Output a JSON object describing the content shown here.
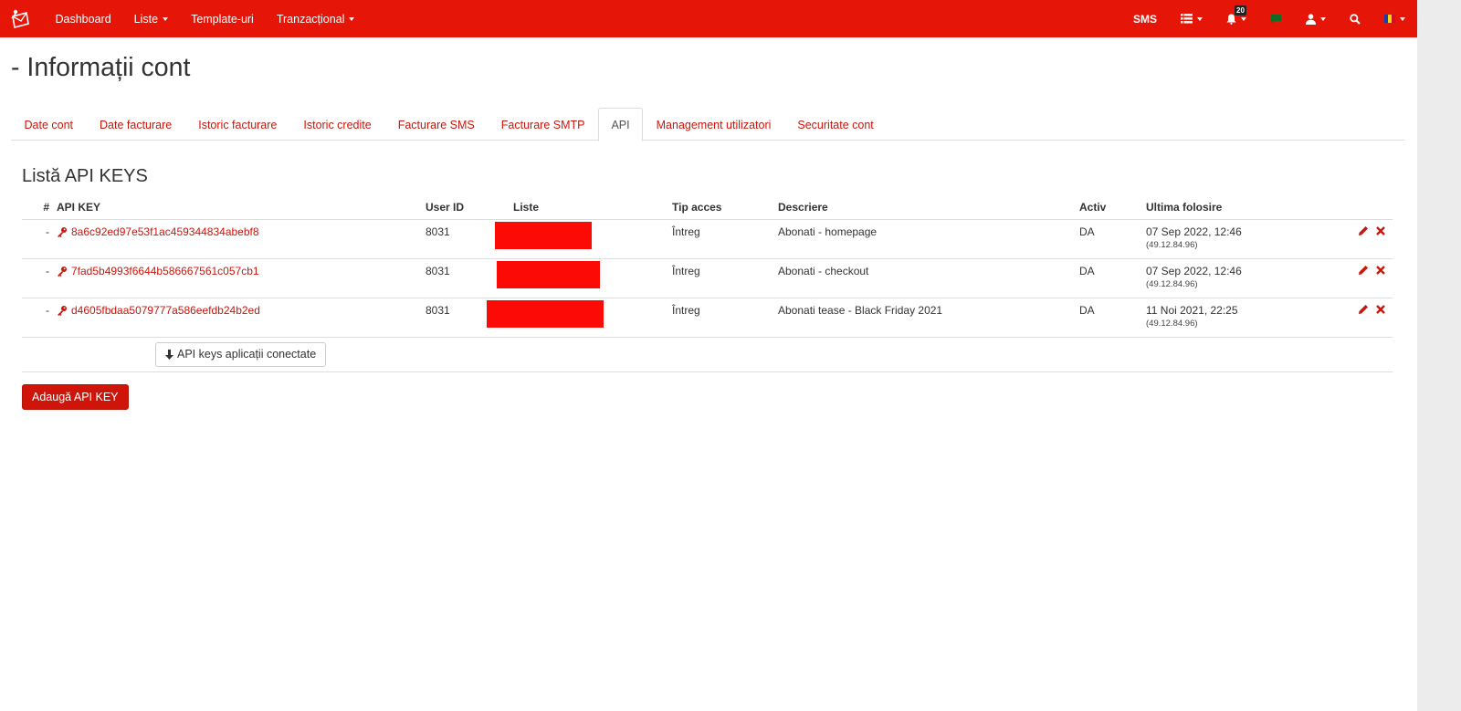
{
  "colors": {
    "brand": "#e51508",
    "link": "#c9170d",
    "redaction": "#fc0a05"
  },
  "navbar": {
    "items": [
      {
        "label": "Dashboard",
        "dropdown": false
      },
      {
        "label": "Liste",
        "dropdown": true
      },
      {
        "label": "Template-uri",
        "dropdown": false
      },
      {
        "label": "Tranzacțional",
        "dropdown": true
      }
    ],
    "sms_label": "SMS",
    "notifications_count": "20"
  },
  "page": {
    "title": "- Informații cont"
  },
  "tabs": [
    {
      "label": "Date cont",
      "active": false
    },
    {
      "label": "Date facturare",
      "active": false
    },
    {
      "label": "Istoric facturare",
      "active": false
    },
    {
      "label": "Istoric credite",
      "active": false
    },
    {
      "label": "Facturare SMS",
      "active": false
    },
    {
      "label": "Facturare SMTP",
      "active": false
    },
    {
      "label": "API",
      "active": true
    },
    {
      "label": "Management utilizatori",
      "active": false
    },
    {
      "label": "Securitate cont",
      "active": false
    }
  ],
  "section": {
    "title": "Listă API KEYS"
  },
  "table": {
    "headers": [
      "#",
      "API KEY",
      "User ID",
      "Liste",
      "Tip acces",
      "Descriere",
      "Activ",
      "Ultima folosire"
    ],
    "rows": [
      {
        "num": "-",
        "key": "8a6c92ed97e53f1ac459344834abebf8",
        "user_id": "8031",
        "access": "Întreg",
        "description": "Abonati - homepage",
        "active": "DA",
        "last_used": "07 Sep 2022, 12:46",
        "ip": "(49.12.84.96)"
      },
      {
        "num": "-",
        "key": "7fad5b4993f6644b586667561c057cb1",
        "user_id": "8031",
        "access": "Întreg",
        "description": "Abonati - checkout",
        "active": "DA",
        "last_used": "07 Sep 2022, 12:46",
        "ip": "(49.12.84.96)"
      },
      {
        "num": "-",
        "key": "d4605fbdaa5079777a586eefdb24b2ed",
        "user_id": "8031",
        "access": "Întreg",
        "description": "Abonati tease - Black Friday 2021",
        "active": "DA",
        "last_used": "11 Noi 2021, 22:25",
        "ip": "(49.12.84.96)"
      }
    ],
    "connected_apps_button": "API keys aplicații conectate"
  },
  "add_button": "Adaugă API KEY"
}
